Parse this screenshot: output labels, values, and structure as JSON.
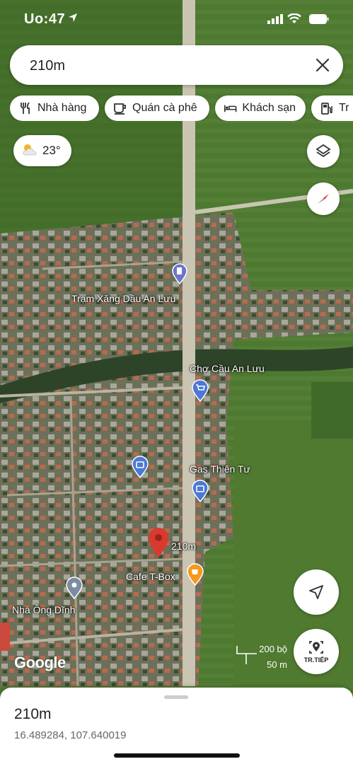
{
  "status_bar": {
    "time": "Uo:47",
    "location_icon": "location-arrow-icon",
    "signal_icon": "cellular-signal-icon",
    "wifi_icon": "wifi-icon",
    "battery_icon": "battery-icon"
  },
  "search": {
    "value": "210m",
    "close_icon": "close-icon"
  },
  "categories": [
    {
      "label": "Nhà hàng",
      "icon": "restaurant-icon"
    },
    {
      "label": "Quán cà phê",
      "icon": "coffee-cup-icon"
    },
    {
      "label": "Khách sạn",
      "icon": "bed-icon"
    },
    {
      "label": "Tr",
      "icon": "gas-pump-icon"
    }
  ],
  "weather": {
    "temperature": "23°",
    "icon": "partly-cloudy-icon"
  },
  "map": {
    "labels": [
      {
        "text": "Trạm Xăng Dầu An Lưu"
      },
      {
        "text": "Chợ Cầu An Lưu"
      },
      {
        "text": "Gas Thiên Tư"
      },
      {
        "text": "210m"
      },
      {
        "text": "Cafe T-Box"
      },
      {
        "text": "Nhà Ông Dĩnh"
      }
    ],
    "scale": {
      "top": "200 bộ",
      "bottom": "50 m"
    },
    "watermark": "Google",
    "colors": {
      "road": "#c8c4b0",
      "river": "#2f4a2a",
      "field": "#4e7a32",
      "village": "#7d7d6a",
      "pin_red": "#d93a2f",
      "poi_blue": "#4c78d6",
      "cafe_orange": "#f29a1c"
    }
  },
  "controls": {
    "next_label": "TR.TIẾP"
  },
  "sheet": {
    "title": "210m",
    "coordinates": "16.489284, 107.640019"
  }
}
